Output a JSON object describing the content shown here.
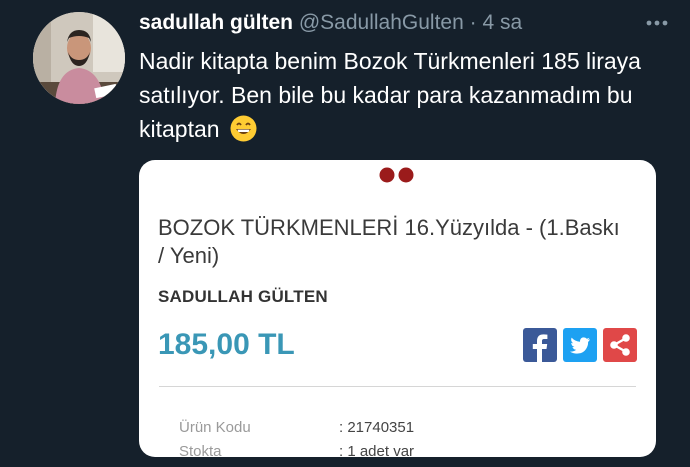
{
  "tweet": {
    "display_name": "sadullah gülten",
    "handle": "@SadullahGulten",
    "separator": "·",
    "time": "4 sa",
    "text": "Nadir kitapta benim Bozok Türkmenleri 185 liraya satılıyor. Ben bile bu kadar para kazanmadım bu kitaptan",
    "emoji": "grinning-face-with-smiling-eyes-emoji"
  },
  "card": {
    "book_title": "BOZOK TÜRKMENLERİ 16.Yüzyılda - (1.Baskı / Yeni)",
    "author": "SADULLAH GÜLTEN",
    "price": "185,00 TL",
    "share_icons": [
      "facebook-icon",
      "twitter-icon",
      "share-icon"
    ],
    "specs": [
      {
        "label": "Ürün Kodu",
        "value": ": 21740351"
      },
      {
        "label": "Stokta",
        "value": ": 1 adet var"
      }
    ]
  },
  "colors": {
    "background": "#15202b",
    "price": "#3a97b6",
    "facebook": "#3b5998",
    "twitter": "#1da1f2",
    "share": "#e04848",
    "logo_dots": "#9b1b1b"
  }
}
